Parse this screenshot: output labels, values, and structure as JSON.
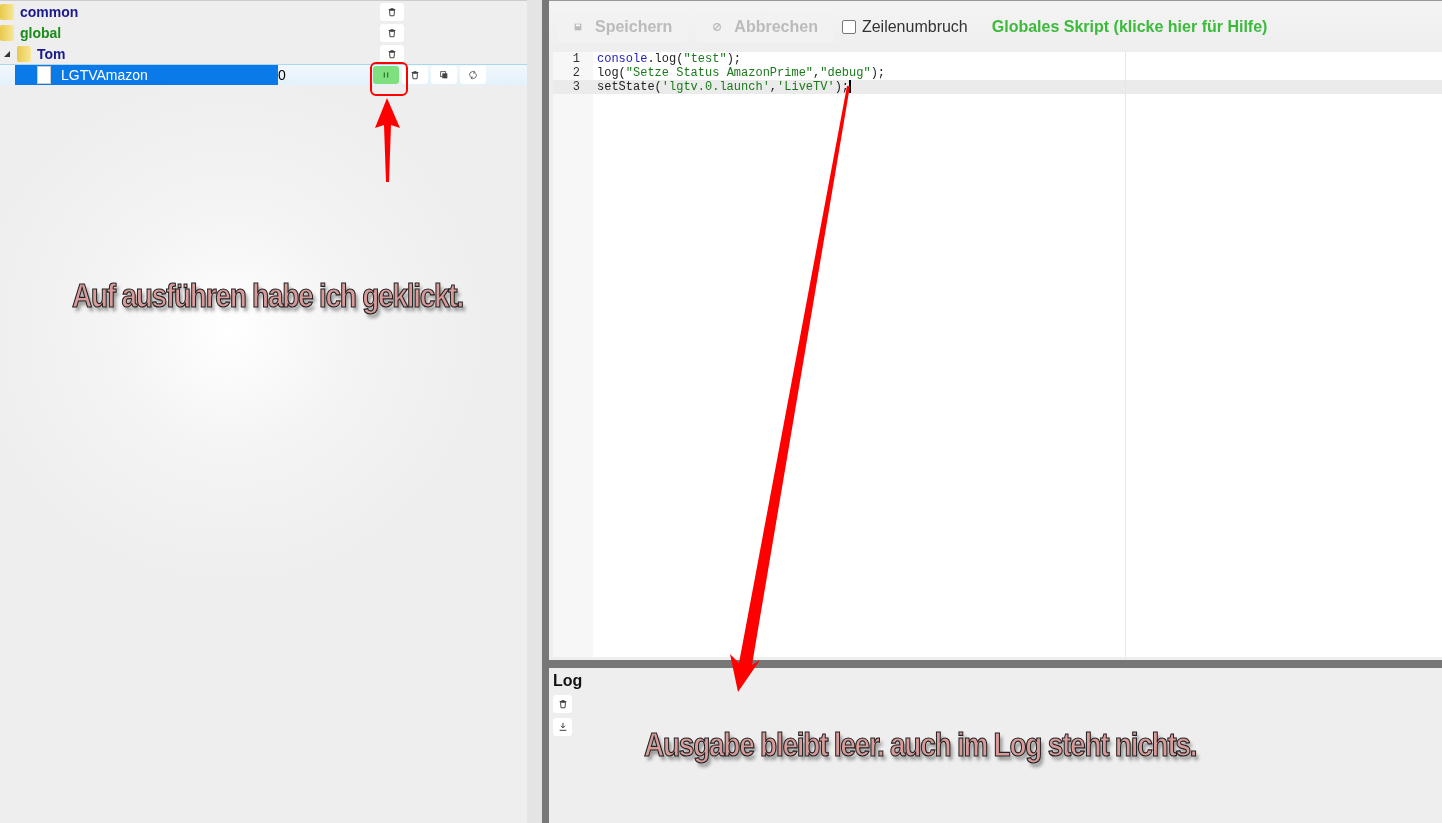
{
  "tree": {
    "items": [
      {
        "kind": "folder",
        "label": "common",
        "color": "#1a1a8c"
      },
      {
        "kind": "folder",
        "label": "global",
        "color": "#1a8c1a"
      },
      {
        "kind": "folder",
        "label": "Tom",
        "color": "#1a1a8c",
        "expanded": true,
        "children": [
          {
            "kind": "script",
            "label": "LGTVAmazon",
            "value": "0",
            "running": true,
            "selected": true
          }
        ]
      }
    ]
  },
  "toolbar": {
    "save": "Speichern",
    "cancel": "Abbrechen",
    "wrap": {
      "label": "Zeilenumbruch",
      "checked": false
    },
    "hint": "Globales Skript (klicke hier für Hilfe)"
  },
  "editor": {
    "lines": [
      {
        "number": "1",
        "current": false,
        "tokens": [
          {
            "kind": "ident",
            "text": "console"
          },
          {
            "kind": "plain",
            "text": ".log("
          },
          {
            "kind": "string",
            "text": "\"test\""
          },
          {
            "kind": "plain",
            "text": ");"
          }
        ]
      },
      {
        "number": "2",
        "current": false,
        "tokens": [
          {
            "kind": "plain",
            "text": "log("
          },
          {
            "kind": "string",
            "text": "\"Setze Status AmazonPrime\""
          },
          {
            "kind": "plain",
            "text": ","
          },
          {
            "kind": "string",
            "text": "\"debug\""
          },
          {
            "kind": "plain",
            "text": ");"
          }
        ]
      },
      {
        "number": "3",
        "current": true,
        "tokens": [
          {
            "kind": "plain",
            "text": "setState("
          },
          {
            "kind": "string",
            "text": "'lgtv.0.launch'"
          },
          {
            "kind": "plain",
            "text": ","
          },
          {
            "kind": "string",
            "text": "'LiveTV'"
          },
          {
            "kind": "plain",
            "text": ");"
          }
        ]
      }
    ]
  },
  "log": {
    "title": "Log"
  },
  "annotations": [
    "Auf ausführen habe ich geklickt.",
    "Ausgabe bleibt leer. auch im Log steht nichts."
  ]
}
